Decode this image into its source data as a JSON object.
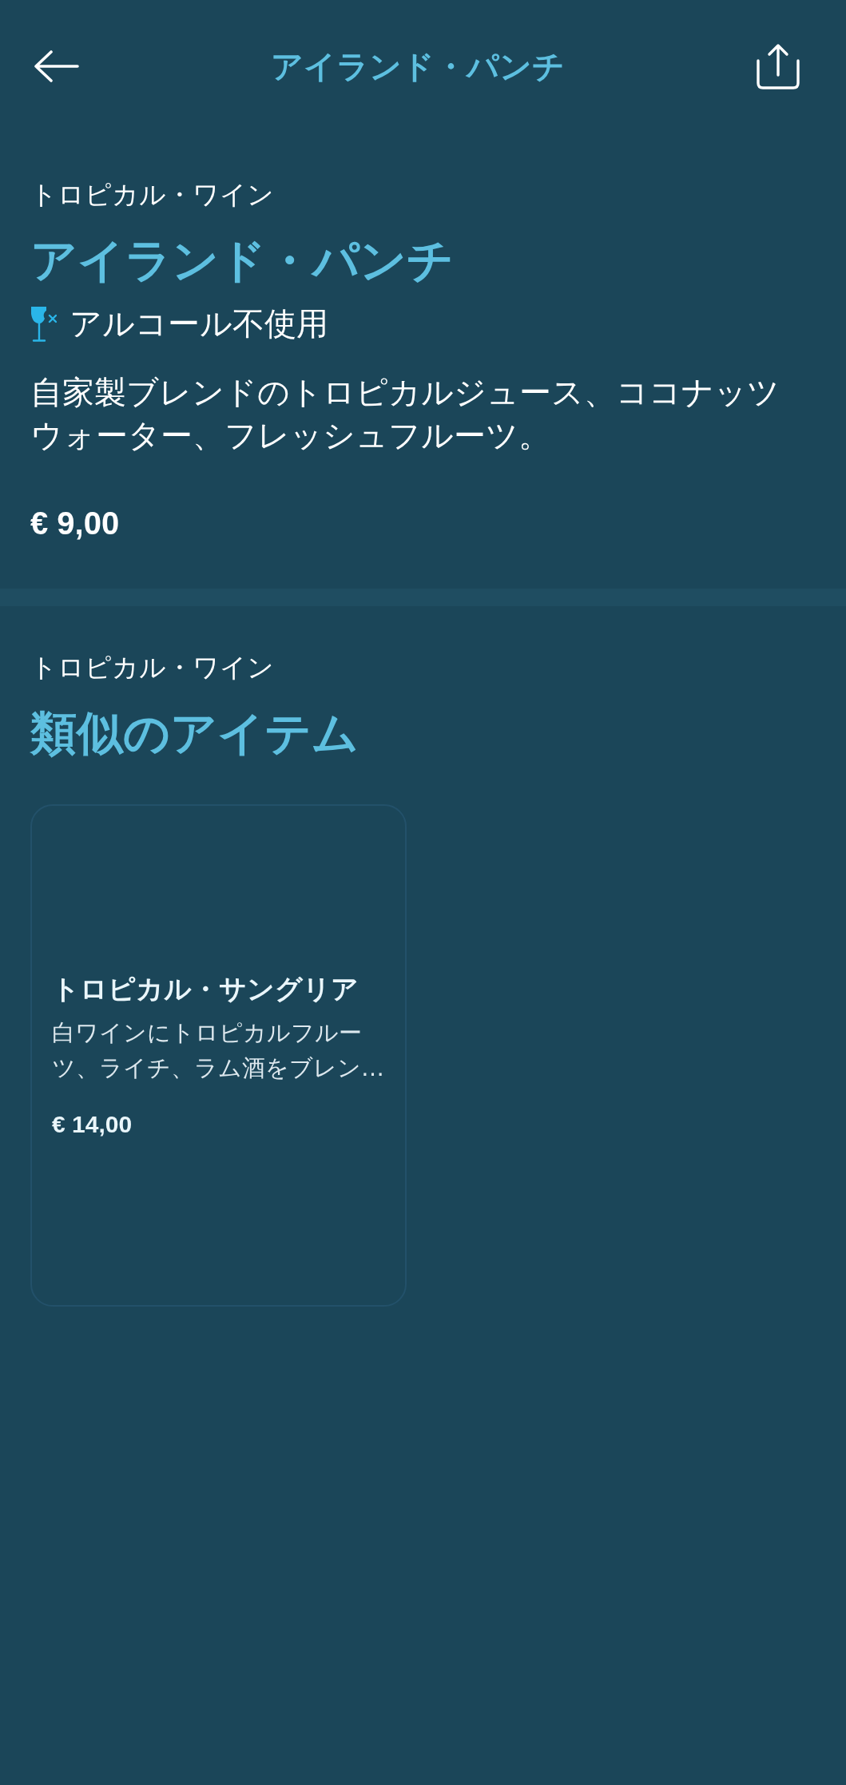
{
  "header": {
    "title": "アイランド・パンチ"
  },
  "product": {
    "category": "トロピカル・ワイン",
    "name": "アイランド・パンチ",
    "tags": [
      {
        "kind": "non_alcoholic",
        "label": "アルコール不使用"
      }
    ],
    "description": "自家製ブレンドのトロピカルジュース、ココナッツウォーター、フレッシュフルーツ。",
    "price": "€ 9,00"
  },
  "similar": {
    "category": "トロピカル・ワイン",
    "title": "類似のアイテム",
    "items": [
      {
        "name": "トロピカル・サングリア",
        "description": "白ワインにトロピカルフルーツ、ライチ、ラム酒をブレン…",
        "price": "€ 14,00"
      }
    ]
  }
}
